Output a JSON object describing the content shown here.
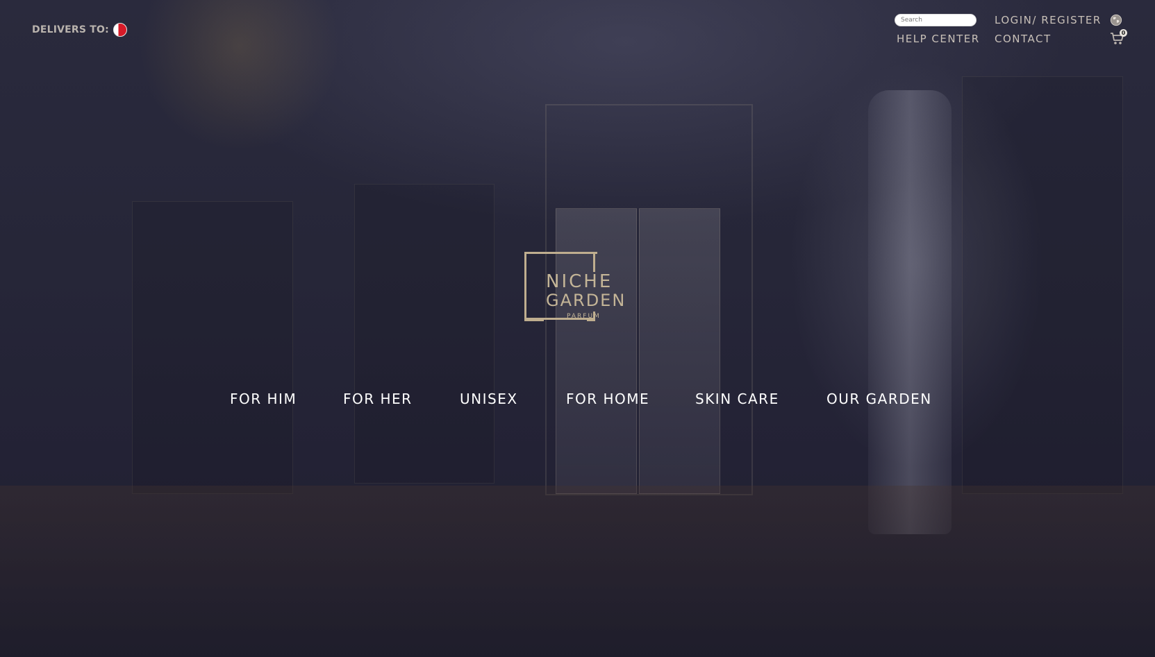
{
  "header": {
    "delivers_label": "DELIVERS TO:",
    "search_placeholder": "Search",
    "login_label": "LOGIN/ REGISTER",
    "help_label": "HELP CENTER",
    "contact_label": "CONTACT",
    "cart_count": "0",
    "icons": [
      "flag-icon",
      "globe-icon",
      "cart-icon"
    ]
  },
  "logo": {
    "line1": "NICHE",
    "line2": "GARDEN",
    "line3": "PARFUM"
  },
  "nav": {
    "items": [
      {
        "label": "FOR HIM"
      },
      {
        "label": "FOR HER"
      },
      {
        "label": "UNISEX"
      },
      {
        "label": "FOR HOME"
      },
      {
        "label": "SKIN CARE"
      },
      {
        "label": "OUR GARDEN"
      }
    ]
  },
  "colors": {
    "background": "#232334",
    "gold": "#c4b597",
    "header_text": "#c8c0b8",
    "nav_text": "#ffffff",
    "flag_red": "#d71a28"
  }
}
